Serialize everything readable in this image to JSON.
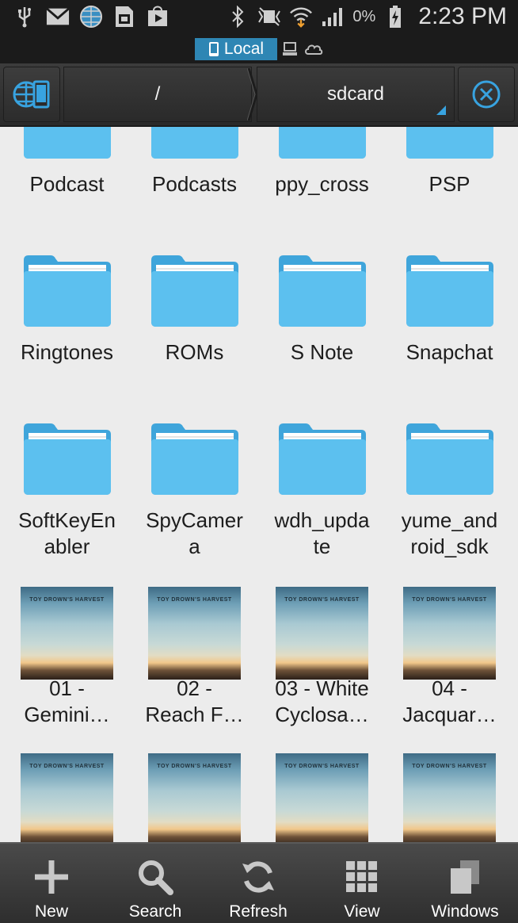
{
  "status_bar": {
    "icons_left": [
      "usb-icon",
      "gmail-icon",
      "globe-icon",
      "storage-icon",
      "play-store-icon"
    ],
    "icons_right": [
      "bluetooth-icon",
      "silent-icon",
      "wifi-icon",
      "signal-icon"
    ],
    "battery_percent": "0%",
    "time": "2:23 PM"
  },
  "location": {
    "active_label": "Local"
  },
  "path_bar": {
    "root": "/",
    "current": "sdcard"
  },
  "items": [
    {
      "label": "Podcast",
      "kind": "folder"
    },
    {
      "label": "Podcasts",
      "kind": "folder"
    },
    {
      "label": "ppy_cross",
      "kind": "folder"
    },
    {
      "label": "PSP",
      "kind": "folder"
    },
    {
      "label": "Ringtones",
      "kind": "folder"
    },
    {
      "label": "ROMs",
      "kind": "folder"
    },
    {
      "label": "S Note",
      "kind": "folder"
    },
    {
      "label": "Snapchat",
      "kind": "folder"
    },
    {
      "label": "SoftKeyEn\nabler",
      "kind": "folder"
    },
    {
      "label": "SpyCamer\na",
      "kind": "folder"
    },
    {
      "label": "wdh_upda\nte",
      "kind": "folder"
    },
    {
      "label": "yume_and\nroid_sdk",
      "kind": "folder"
    },
    {
      "label": "01 -\nGemini…",
      "kind": "audio"
    },
    {
      "label": "02 -\nReach F…",
      "kind": "audio"
    },
    {
      "label": "03 - White\nCyclosa…",
      "kind": "audio"
    },
    {
      "label": "04 -\nJacquar…",
      "kind": "audio"
    },
    {
      "label": "",
      "kind": "audio"
    },
    {
      "label": "",
      "kind": "audio"
    },
    {
      "label": "",
      "kind": "audio"
    },
    {
      "label": "",
      "kind": "audio"
    }
  ],
  "album_art_text": "TOY DROWN'S HARVEST",
  "toolbar": {
    "new": "New",
    "search": "Search",
    "refresh": "Refresh",
    "view": "View",
    "windows": "Windows"
  }
}
